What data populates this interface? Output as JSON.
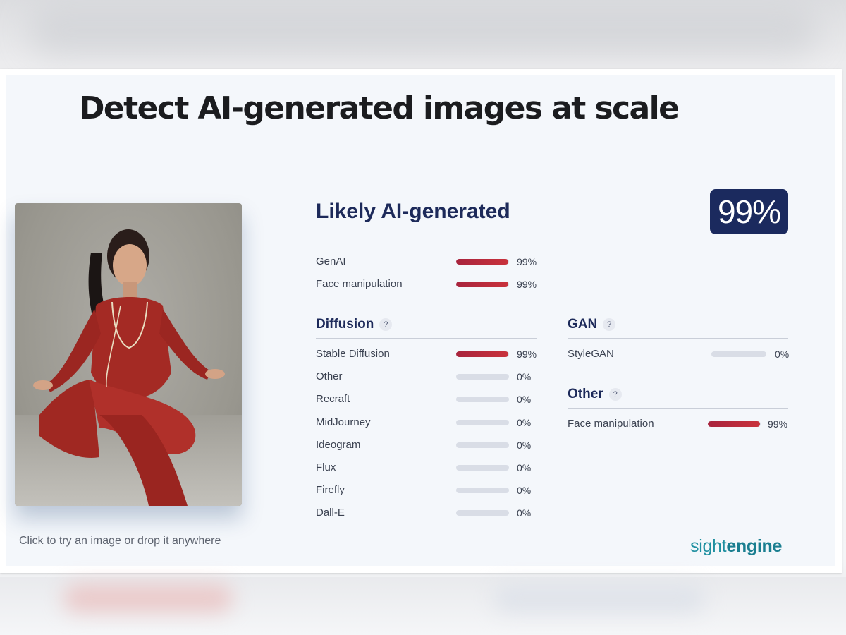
{
  "headline": "Detect AI-generated images at scale",
  "upload_hint": "Click to try an image or drop it anywhere",
  "verdict": {
    "label": "Likely AI-generated",
    "score": "99%"
  },
  "summary": [
    {
      "label": "GenAI",
      "value": 0.99,
      "text": "99%"
    },
    {
      "label": "Face manipulation",
      "value": 0.99,
      "text": "99%"
    }
  ],
  "diffusion": {
    "title": "Diffusion",
    "help": "?",
    "items": [
      {
        "label": "Stable Diffusion",
        "value": 0.99,
        "text": "99%"
      },
      {
        "label": "Other",
        "value": 0,
        "text": "0%"
      },
      {
        "label": "Recraft",
        "value": 0,
        "text": "0%"
      },
      {
        "label": "MidJourney",
        "value": 0,
        "text": "0%"
      },
      {
        "label": "Ideogram",
        "value": 0,
        "text": "0%"
      },
      {
        "label": "Flux",
        "value": 0,
        "text": "0%"
      },
      {
        "label": "Firefly",
        "value": 0,
        "text": "0%"
      },
      {
        "label": "Dall-E",
        "value": 0,
        "text": "0%"
      }
    ]
  },
  "gan": {
    "title": "GAN",
    "help": "?",
    "items": [
      {
        "label": "StyleGAN",
        "value": 0,
        "text": "0%"
      }
    ]
  },
  "other": {
    "title": "Other",
    "help": "?",
    "items": [
      {
        "label": "Face manipulation",
        "value": 0.99,
        "text": "99%"
      }
    ]
  },
  "logo": {
    "part1": "sight",
    "part2": "engine"
  },
  "colors": {
    "accent_navy": "#1b2a5e",
    "bar_fill": "#c2303c",
    "bar_track": "#d9dde6",
    "logo_teal": "#1e8fa0"
  }
}
